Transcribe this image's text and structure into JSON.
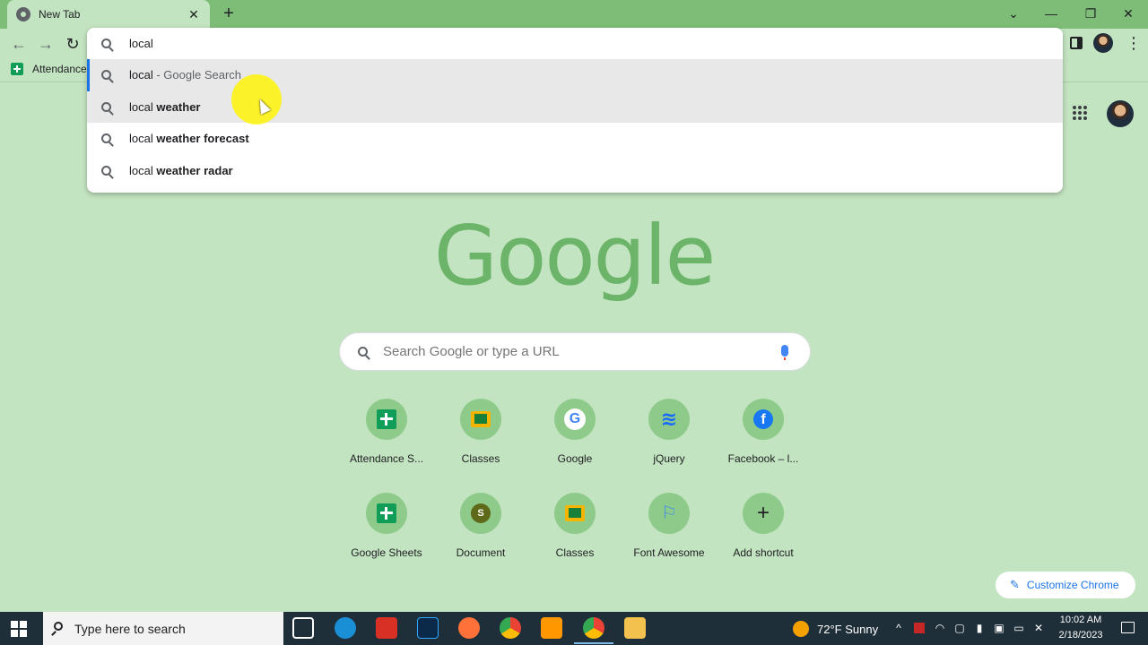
{
  "tab": {
    "title": "New Tab",
    "close": "✕"
  },
  "new_tab_symbol": "+",
  "window_controls": {
    "tablist": "⌄",
    "minimize": "—",
    "restore": "❐",
    "close": "✕"
  },
  "nav": {
    "back": "←",
    "forward": "→",
    "reload": "↻"
  },
  "bookmarks": [
    {
      "label": "Attendance"
    }
  ],
  "omnibox": {
    "input": "local",
    "suggestions": [
      {
        "typed": "local",
        "rest": "",
        "suffix": " - Google Search"
      },
      {
        "typed": "local ",
        "rest": "weather",
        "suffix": ""
      },
      {
        "typed": "local ",
        "rest": "weather forecast",
        "suffix": ""
      },
      {
        "typed": "local ",
        "rest": "weather radar",
        "suffix": ""
      }
    ]
  },
  "logo": "Google",
  "search": {
    "placeholder": "Search Google or type a URL"
  },
  "shortcuts": [
    {
      "label": "Attendance S...",
      "icon": "sheets-icon"
    },
    {
      "label": "Classes",
      "icon": "classroom-icon"
    },
    {
      "label": "Google",
      "icon": "google-icon",
      "glyph": "G"
    },
    {
      "label": "jQuery",
      "icon": "jquery-icon",
      "glyph": "≋"
    },
    {
      "label": "Facebook – l...",
      "icon": "facebook-icon",
      "glyph": "f"
    },
    {
      "label": "Google Sheets",
      "icon": "sheets-icon"
    },
    {
      "label": "Document",
      "icon": "document-icon",
      "glyph": "S"
    },
    {
      "label": "Classes",
      "icon": "classroom-icon"
    },
    {
      "label": "Font Awesome",
      "icon": "flag-icon",
      "glyph": "⚐"
    },
    {
      "label": "Add shortcut",
      "icon": "plus-icon",
      "glyph": "+"
    }
  ],
  "customize": {
    "label": "Customize Chrome",
    "icon": "✎"
  },
  "taskbar": {
    "search_text": "Type here to search",
    "weather": "72°F  Sunny",
    "time": "10:02 AM",
    "date": "2/18/2023",
    "tray_chevron": "^"
  }
}
